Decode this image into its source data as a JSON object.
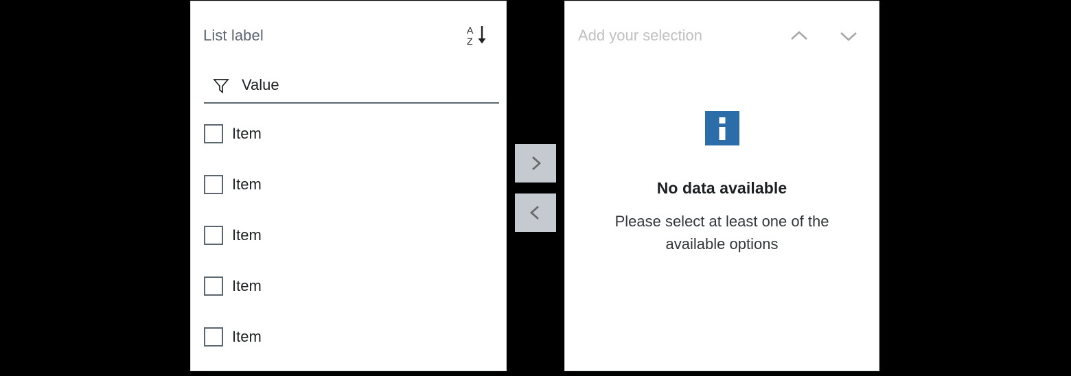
{
  "colors": {
    "background": "#000000",
    "panel_background": "#ffffff",
    "panel_border": "#d9dde1",
    "label_gray": "#5a6673",
    "text_dark": "#1d2022",
    "placeholder_gray": "#c0c0c0",
    "transfer_button_bg": "#c5cad1",
    "chevron_gray": "#6a6a6a",
    "header_chevron_gray": "#a8a8a8",
    "info_blue": "#2a6da8"
  },
  "left_panel": {
    "title": "List label",
    "sort_icon": {
      "name": "sort-ascending-icon",
      "top_letter": "A",
      "bottom_letter": "Z"
    },
    "filter": {
      "icon": "filter-funnel-icon",
      "value": "Value",
      "placeholder": "Value"
    },
    "items": [
      {
        "label": "Item",
        "checked": false
      },
      {
        "label": "Item",
        "checked": false
      },
      {
        "label": "Item",
        "checked": false
      },
      {
        "label": "Item",
        "checked": false
      },
      {
        "label": "Item",
        "checked": false
      }
    ]
  },
  "transfer": {
    "move_right": {
      "icon": "chevron-right-icon",
      "label": ""
    },
    "move_left": {
      "icon": "chevron-left-icon",
      "label": ""
    }
  },
  "right_panel": {
    "title": "Add your selection",
    "collapse_up_icon": "chevron-up-icon",
    "collapse_down_icon": "chevron-down-icon",
    "empty_state": {
      "icon": "info-icon",
      "title": "No data available",
      "description": "Please select at least one of the available options"
    }
  }
}
